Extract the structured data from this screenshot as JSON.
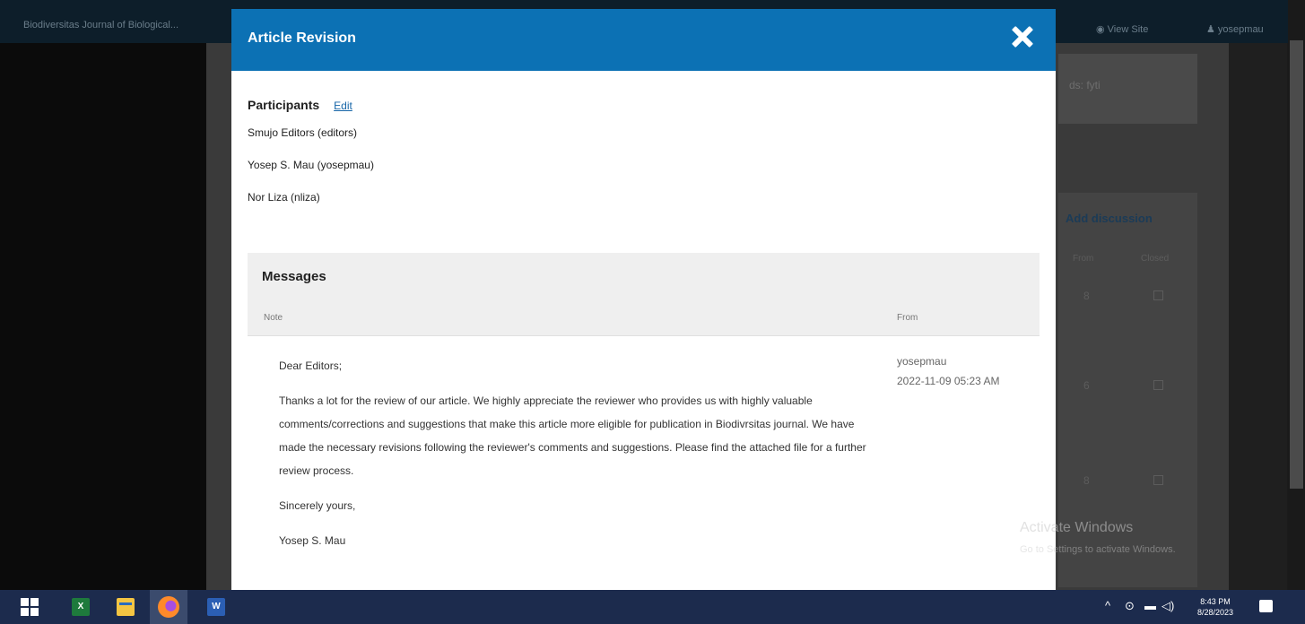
{
  "background": {
    "journal_name": "Biodiversitas Journal of Biological...",
    "view_site": "View Site",
    "user_menu": "yosepmau",
    "panel_fyi": "ds: fyti",
    "add_discussion": "Add discussion",
    "col_from": "From",
    "col_closed": "Closed",
    "rows": [
      "8",
      "6",
      "8"
    ]
  },
  "modal": {
    "title": "Article Revision",
    "participants": {
      "title": "Participants",
      "edit_label": "Edit",
      "list": [
        "Smujo Editors (editors)",
        "Yosep S. Mau (yosepmau)",
        "Nor Liza (nliza)"
      ]
    },
    "messages": {
      "title": "Messages",
      "col_note": "Note",
      "col_from": "From",
      "message": {
        "paragraphs": [
          "Dear Editors;",
          "Thanks a lot for the review of our article. We highly appreciate the reviewer who provides us with highly valuable comments/corrections and suggestions that make this article more eligible for publication in Biodivrsitas journal. We have made the necessary revisions following the reviewer's comments and suggestions. Please find the attached file for a further review process.",
          "Sincerely yours,",
          "Yosep S. Mau"
        ],
        "from_user": "yosepmau",
        "date": "2022-11-09 05:23 AM"
      }
    }
  },
  "watermark": {
    "title": "Activate Windows",
    "subtitle": "Go to Settings to activate Windows."
  },
  "taskbar": {
    "time": "8:43 PM",
    "date": "8/28/2023",
    "icons": [
      "windows-start-icon",
      "excel-icon",
      "file-explorer-icon",
      "firefox-icon",
      "word-icon"
    ]
  }
}
